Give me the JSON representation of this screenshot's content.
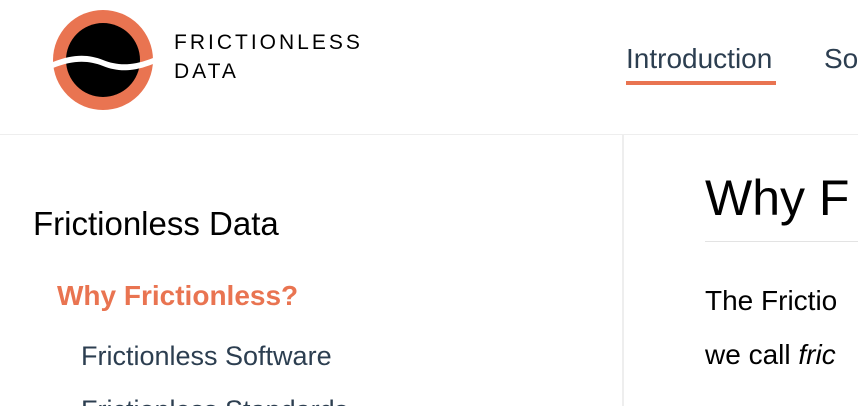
{
  "header": {
    "logo": {
      "line1": "FRICTIONLESS",
      "line2": "DATA",
      "colors": {
        "ring": "#e97451",
        "core": "#000000",
        "wave": "#ffffff"
      }
    },
    "nav": [
      {
        "label": "Introduction",
        "active": true
      },
      {
        "label": "So"
      }
    ],
    "accent_color": "#e97451"
  },
  "sidebar": {
    "title": "Frictionless Data",
    "active_item": "Why Frictionless?",
    "sub_items": [
      "Frictionless Software",
      "Frictionless Standards"
    ]
  },
  "main": {
    "title": "Why F",
    "paragraph_lines": [
      {
        "text": "The Frictio"
      },
      {
        "prefix": "we call ",
        "emphasis": "fric"
      }
    ]
  }
}
